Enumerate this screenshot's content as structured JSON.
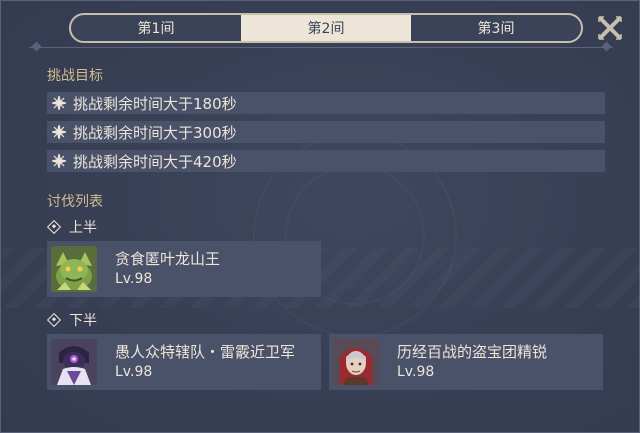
{
  "tabs": [
    {
      "label": "第1间",
      "active": false
    },
    {
      "label": "第2间",
      "active": true
    },
    {
      "label": "第3间",
      "active": false
    }
  ],
  "close_icon": "close-x-icon",
  "goals": {
    "label": "挑战目标",
    "items": [
      {
        "icon": "star-snowflake-icon",
        "text": "挑战剩余时间大于180秒"
      },
      {
        "icon": "star-snowflake-icon",
        "text": "挑战剩余时间大于300秒"
      },
      {
        "icon": "star-snowflake-icon",
        "text": "挑战剩余时间大于420秒"
      }
    ]
  },
  "enemies": {
    "label": "讨伐列表",
    "upper": {
      "label": "上半",
      "list": [
        {
          "name": "贪食匿叶龙山王",
          "level": "Lv.98",
          "portrait": "green-dragon-portrait"
        }
      ]
    },
    "lower": {
      "label": "下半",
      "list": [
        {
          "name": "愚人众特辖队・雷霰近卫军",
          "level": "Lv.98",
          "portrait": "fatui-guard-portrait"
        },
        {
          "name": "历经百战的盗宝团精锐",
          "level": "Lv.98",
          "portrait": "treasure-hoarder-portrait"
        }
      ]
    }
  },
  "colors": {
    "background": "#3a4258",
    "row": "#4a526a",
    "accent_gold": "#d3bc8e",
    "text": "#ece5d8"
  }
}
